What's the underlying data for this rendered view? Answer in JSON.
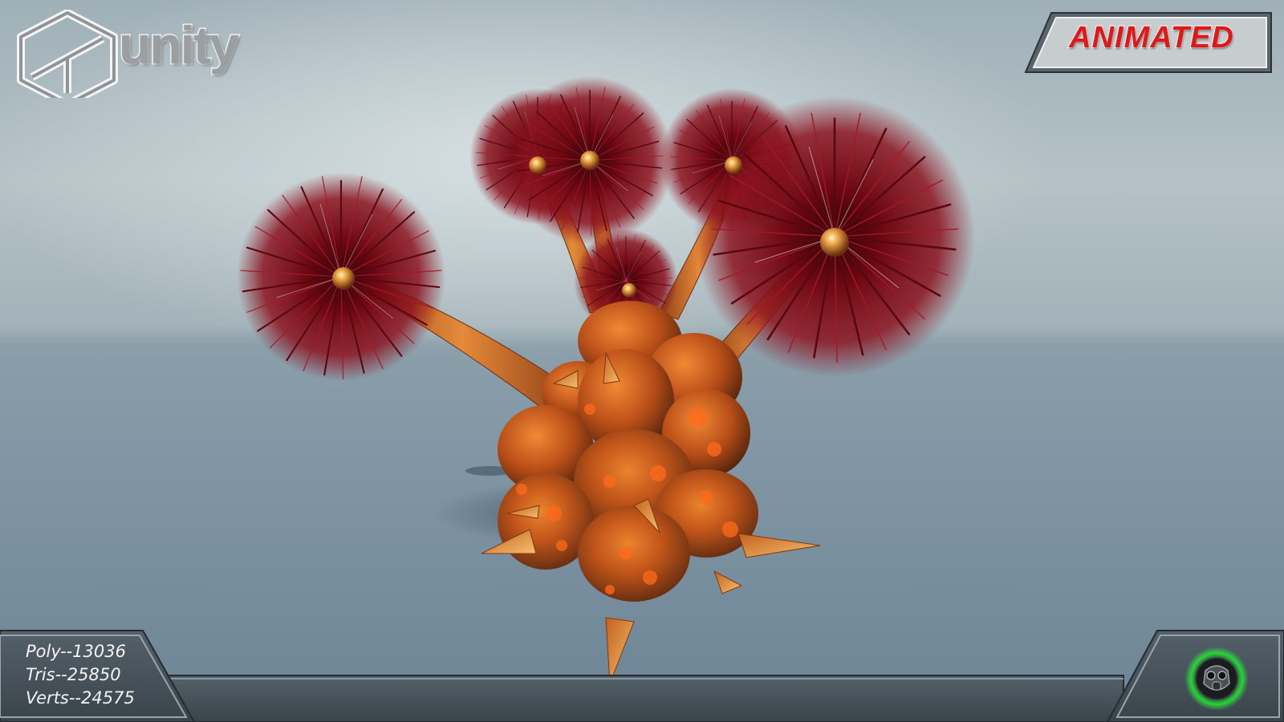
{
  "branding": {
    "engine_logo_text": "unity",
    "badge_text": "ANIMATED"
  },
  "stats": {
    "poly": "Poly--13036",
    "tris": "Tris--25850",
    "verts": "Verts--24575"
  },
  "corner_logo": "gas-mask-icon",
  "colors": {
    "badge_red": "#e01818",
    "fur_red": "#7a0a14",
    "body_orange": "#d9621c",
    "panel_dark": "#3f4a52",
    "glow_green": "#28e03a"
  }
}
